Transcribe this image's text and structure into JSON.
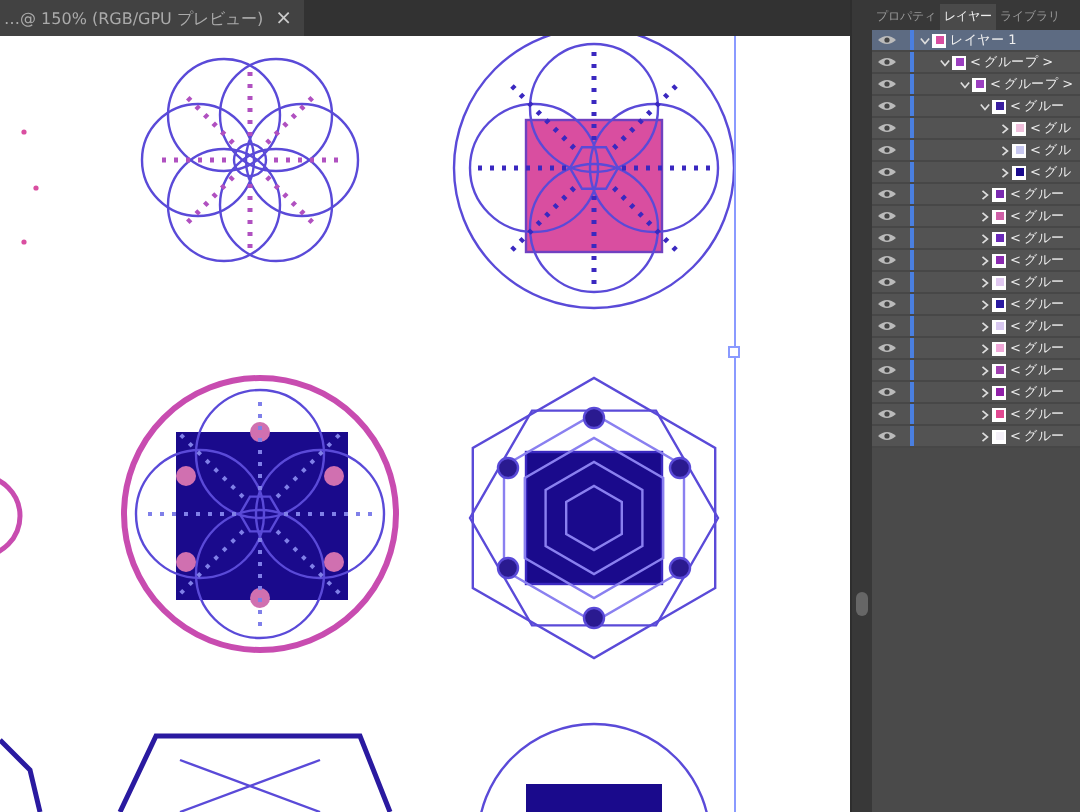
{
  "document_tab": {
    "title": "…@ 150% (RGB/GPU プレビュー)",
    "close": "×"
  },
  "panel_tabs": [
    {
      "label": "プロパティ",
      "selected": false
    },
    {
      "label": "レイヤー",
      "selected": true
    },
    {
      "label": "ライブラリ",
      "selected": false
    }
  ],
  "layers": [
    {
      "name": "レイヤー 1",
      "expanded": true,
      "selected": true,
      "color": "#d94ea0",
      "children": [
        {
          "name": "< グループ >",
          "expanded": true,
          "selected": false,
          "color": "#9b3fc0",
          "children": [
            {
              "name": "< グループ >",
              "expanded": true,
              "selected": false,
              "color": "#9b3fc0",
              "children": [
                {
                  "name": "< グルー",
                  "expanded": true,
                  "selected": false,
                  "color": "#3a1fa0",
                  "children": [
                    {
                      "name": "< グル",
                      "expanded": false,
                      "selected": false,
                      "color": "#f0c0dc"
                    },
                    {
                      "name": "< グル",
                      "expanded": false,
                      "selected": false,
                      "color": "#c8c8f0"
                    },
                    {
                      "name": "< グル",
                      "expanded": false,
                      "selected": false,
                      "color": "#1a0a8c"
                    }
                  ]
                },
                {
                  "name": "< グルー",
                  "expanded": false,
                  "selected": false,
                  "color": "#7a2ab0"
                },
                {
                  "name": "< グルー",
                  "expanded": false,
                  "selected": false,
                  "color": "#d060a8"
                },
                {
                  "name": "< グルー",
                  "expanded": false,
                  "selected": false,
                  "color": "#6a2ab8"
                },
                {
                  "name": "< グルー",
                  "expanded": false,
                  "selected": false,
                  "color": "#8a2ab0"
                },
                {
                  "name": "< グルー",
                  "expanded": false,
                  "selected": false,
                  "color": "#e0c8f0"
                },
                {
                  "name": "< グルー",
                  "expanded": false,
                  "selected": false,
                  "color": "#2a1aa0"
                },
                {
                  "name": "< グルー",
                  "expanded": false,
                  "selected": false,
                  "color": "#d8c8f0"
                },
                {
                  "name": "< グルー",
                  "expanded": false,
                  "selected": false,
                  "color": "#f0a8d8"
                },
                {
                  "name": "< グルー",
                  "expanded": false,
                  "selected": false,
                  "color": "#a040b0"
                },
                {
                  "name": "< グルー",
                  "expanded": false,
                  "selected": false,
                  "color": "#9020a8"
                },
                {
                  "name": "< グルー",
                  "expanded": false,
                  "selected": false,
                  "color": "#e04890"
                },
                {
                  "name": "< グルー",
                  "expanded": false,
                  "selected": false,
                  "color": "#f4f0f8"
                }
              ]
            }
          ]
        }
      ]
    }
  ]
}
